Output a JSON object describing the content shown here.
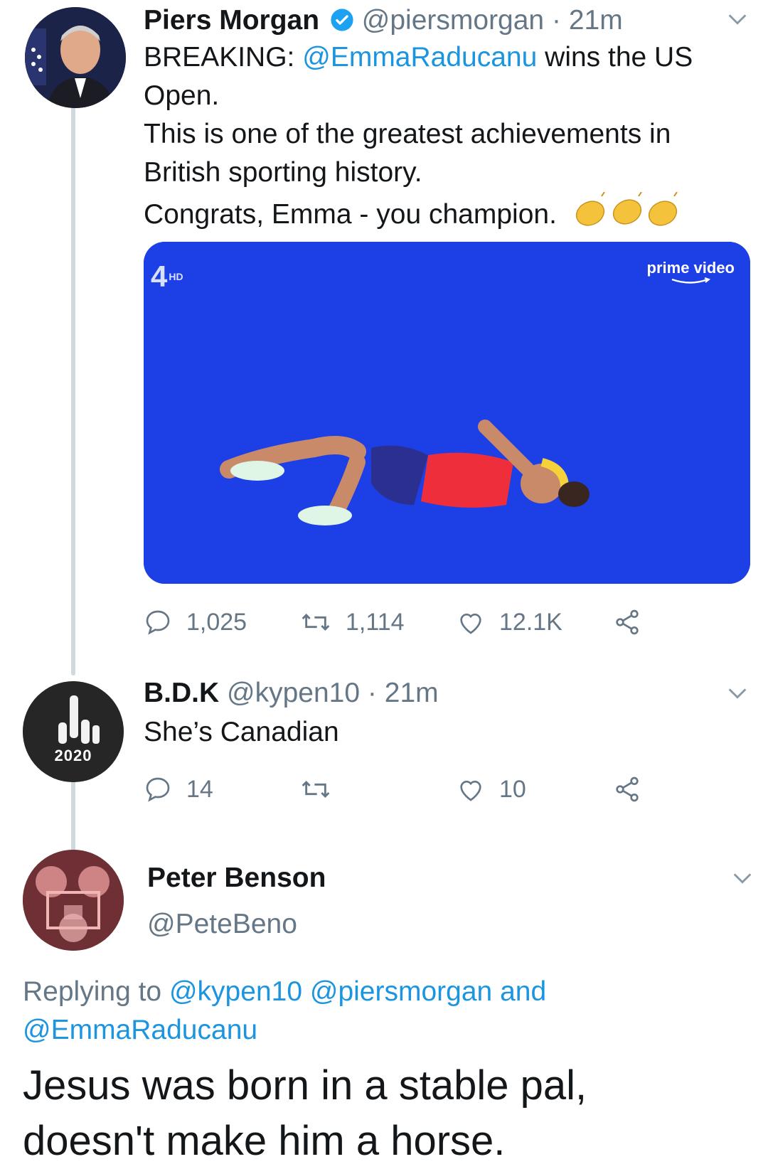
{
  "tweet1": {
    "display_name": "Piers Morgan",
    "handle": "@piersmorgan",
    "separator": "·",
    "time": "21m",
    "lines": [
      {
        "pre": "BREAKING: ",
        "mention": "@EmmaRaducanu",
        "post": " wins the US"
      },
      {
        "text": "Open."
      },
      {
        "text": "This is one of the greatest achievements in"
      },
      {
        "text": "British sporting history."
      },
      {
        "text": "Congrats, Emma - you  champion."
      }
    ],
    "media": {
      "logo_left": "4",
      "logo_left_badge": "HD",
      "logo_right": "prime video"
    },
    "stats": {
      "replies": "1,025",
      "retweets": "1,114",
      "likes": "12.1K"
    }
  },
  "tweet2": {
    "display_name": "B.D.K",
    "handle": "@kypen10",
    "separator": "·",
    "time": "21m",
    "text": "She’s Canadian",
    "avatar_text": "2020",
    "stats": {
      "replies": "14",
      "retweets": "",
      "likes": "10"
    }
  },
  "tweet3": {
    "display_name": "Peter Benson",
    "handle": "@PeteBeno",
    "replying_label": "Replying to",
    "replying_mentions": [
      "@kypen10",
      "@piersmorgan"
    ],
    "replying_and": "and",
    "replying_last": "@EmmaRaducanu",
    "text_lines": [
      "Jesus was born in a stable pal,",
      "doesn't make him a horse."
    ]
  },
  "colors": {
    "link": "#1b95e0",
    "muted": "#657786",
    "verified": "#1da1f2",
    "court": "#1d3fe6"
  }
}
